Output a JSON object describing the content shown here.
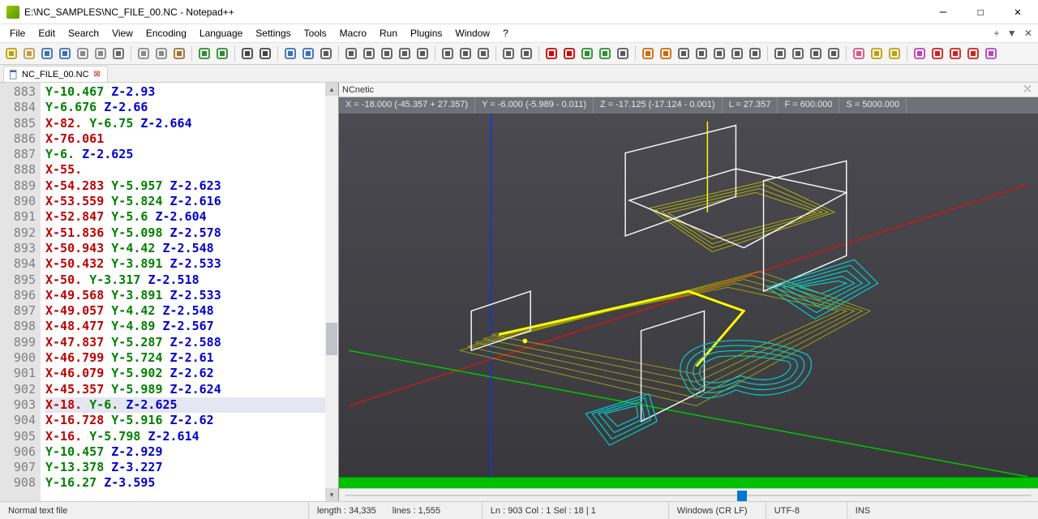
{
  "window": {
    "title": "E:\\NC_SAMPLES\\NC_FILE_00.NC - Notepad++"
  },
  "menu": [
    "File",
    "Edit",
    "Search",
    "View",
    "Encoding",
    "Language",
    "Settings",
    "Tools",
    "Macro",
    "Run",
    "Plugins",
    "Window",
    "?"
  ],
  "tab": {
    "label": "NC_FILE_00.NC"
  },
  "viewer": {
    "title": "NCnetic",
    "coords": {
      "x": "X = -18.000 (-45.357 + 27.357)",
      "y": "Y = -6.000 (-5.989 - 0.011)",
      "z": "Z = -17.125 (-17.124 - 0.001)",
      "l": "L = 27.357",
      "f": "F = 600.000",
      "s": "S = 5000.000"
    }
  },
  "code_lines": [
    {
      "n": 883,
      "y": "Y-10.467",
      "z": "Z-2.93"
    },
    {
      "n": 884,
      "y": "Y-6.676",
      "z": "Z-2.66"
    },
    {
      "n": 885,
      "x": "X-82.",
      "y": "Y-6.75",
      "z": "Z-2.664"
    },
    {
      "n": 886,
      "x": "X-76.061"
    },
    {
      "n": 887,
      "y": "Y-6.",
      "z": "Z-2.625"
    },
    {
      "n": 888,
      "x": "X-55."
    },
    {
      "n": 889,
      "x": "X-54.283",
      "y": "Y-5.957",
      "z": "Z-2.623"
    },
    {
      "n": 890,
      "x": "X-53.559",
      "y": "Y-5.824",
      "z": "Z-2.616"
    },
    {
      "n": 891,
      "x": "X-52.847",
      "y": "Y-5.6",
      "z": "Z-2.604"
    },
    {
      "n": 892,
      "x": "X-51.836",
      "y": "Y-5.098",
      "z": "Z-2.578"
    },
    {
      "n": 893,
      "x": "X-50.943",
      "y": "Y-4.42",
      "z": "Z-2.548"
    },
    {
      "n": 894,
      "x": "X-50.432",
      "y": "Y-3.891",
      "z": "Z-2.533"
    },
    {
      "n": 895,
      "x": "X-50.",
      "y": "Y-3.317",
      "z": "Z-2.518"
    },
    {
      "n": 896,
      "x": "X-49.568",
      "y": "Y-3.891",
      "z": "Z-2.533"
    },
    {
      "n": 897,
      "x": "X-49.057",
      "y": "Y-4.42",
      "z": "Z-2.548"
    },
    {
      "n": 898,
      "x": "X-48.477",
      "y": "Y-4.89",
      "z": "Z-2.567"
    },
    {
      "n": 899,
      "x": "X-47.837",
      "y": "Y-5.287",
      "z": "Z-2.588"
    },
    {
      "n": 900,
      "x": "X-46.799",
      "y": "Y-5.724",
      "z": "Z-2.61"
    },
    {
      "n": 901,
      "x": "X-46.079",
      "y": "Y-5.902",
      "z": "Z-2.62"
    },
    {
      "n": 902,
      "x": "X-45.357",
      "y": "Y-5.989",
      "z": "Z-2.624"
    },
    {
      "n": 903,
      "x": "X-18.",
      "y": "Y-6.",
      "z": "Z-2.625",
      "hl": true
    },
    {
      "n": 904,
      "x": "X-16.728",
      "y": "Y-5.916",
      "z": "Z-2.62"
    },
    {
      "n": 905,
      "x": "X-16.",
      "y": "Y-5.798",
      "z": "Z-2.614"
    },
    {
      "n": 906,
      "y": "Y-10.457",
      "z": "Z-2.929"
    },
    {
      "n": 907,
      "y": "Y-13.378",
      "z": "Z-3.227"
    },
    {
      "n": 908,
      "y": "Y-16.27",
      "z": "Z-3.595"
    }
  ],
  "status": {
    "filetype": "Normal text file",
    "length": "length : 34,335",
    "lines": "lines : 1,555",
    "pos": "Ln : 903    Col : 1    Sel : 18 | 1",
    "eol": "Windows (CR LF)",
    "enc": "UTF-8",
    "ins": "INS"
  },
  "toolbar_groups": [
    [
      "new",
      "open",
      "save",
      "save-all",
      "close",
      "close-all",
      "print"
    ],
    [
      "cut",
      "copy",
      "paste"
    ],
    [
      "undo",
      "redo"
    ],
    [
      "find",
      "replace"
    ],
    [
      "zoom-in",
      "zoom-out",
      "sync-scroll"
    ],
    [
      "wordwrap",
      "all-chars",
      "indent-guide",
      "fold",
      "unfold"
    ],
    [
      "doc-map",
      "doc-list",
      "func-list"
    ],
    [
      "folder-workspace",
      "monitor"
    ],
    [
      "record-macro",
      "stop-macro",
      "play-macro",
      "run-macro",
      "save-macro"
    ],
    [
      "compare-1",
      "compare-clear",
      "compare-nav1",
      "compare-nav2",
      "compare-nav3",
      "compare-nav4",
      "compare-opts"
    ],
    [
      "bookmark",
      "bookmark-next",
      "bookmark-prev",
      "bookmark-clear"
    ],
    [
      "heart",
      "spell",
      "spell2"
    ],
    [
      "nc-prev",
      "nc-play-back",
      "nc-play",
      "nc-next",
      "nc-end"
    ]
  ],
  "toolbar_colors": {
    "default": "#5a5a5a",
    "new": "#c0a000",
    "open": "#c79b45",
    "save": "#3b6fb6",
    "save-all": "#3b6fb6",
    "close": "#888",
    "close-all": "#888",
    "print": "#666",
    "cut": "#888",
    "copy": "#888",
    "paste": "#a07030",
    "undo": "#2a8f2a",
    "redo": "#2a8f2a",
    "find": "#444",
    "replace": "#444",
    "zoom-in": "#3b6fb6",
    "zoom-out": "#3b6fb6",
    "record-macro": "#d00000",
    "stop-macro": "#d00000",
    "play-macro": "#2a8f2a",
    "run-macro": "#2a8f2a",
    "compare-1": "#d06800",
    "compare-clear": "#d06800",
    "heart": "#e05080",
    "spell": "#c0a000",
    "spell2": "#c0a000",
    "nc-prev": "#c040c0",
    "nc-play-back": "#d02020",
    "nc-play": "#d02020",
    "nc-next": "#d02020",
    "nc-end": "#c040c0"
  }
}
